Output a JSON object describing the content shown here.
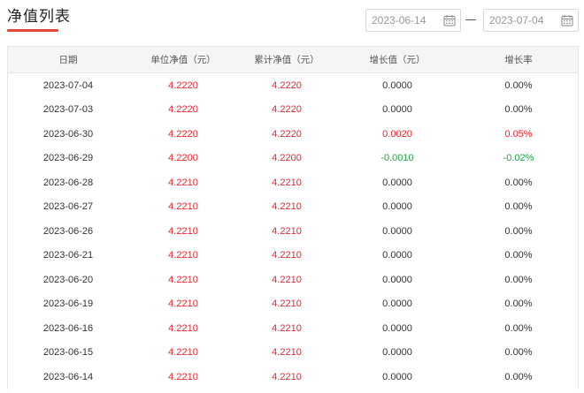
{
  "header": {
    "title": "净值列表"
  },
  "filter": {
    "start_date": "2023-06-14",
    "end_date": "2023-07-04",
    "separator": "—"
  },
  "colors": {
    "accent": "#e8453c",
    "up": "#e8262f",
    "down": "#2aa14a",
    "neutral": "#333333"
  },
  "table": {
    "columns": [
      "日期",
      "单位净值（元）",
      "累计净值（元）",
      "增长值（元）",
      "增长率"
    ],
    "rows": [
      [
        "2023-07-04",
        "4.2220",
        "4.2220",
        "0.0000",
        "0.00%",
        "flat"
      ],
      [
        "2023-07-03",
        "4.2220",
        "4.2220",
        "0.0000",
        "0.00%",
        "flat"
      ],
      [
        "2023-06-30",
        "4.2220",
        "4.2220",
        "0.0020",
        "0.05%",
        "up"
      ],
      [
        "2023-06-29",
        "4.2200",
        "4.2200",
        "-0.0010",
        "-0.02%",
        "down"
      ],
      [
        "2023-06-28",
        "4.2210",
        "4.2210",
        "0.0000",
        "0.00%",
        "flat"
      ],
      [
        "2023-06-27",
        "4.2210",
        "4.2210",
        "0.0000",
        "0.00%",
        "flat"
      ],
      [
        "2023-06-26",
        "4.2210",
        "4.2210",
        "0.0000",
        "0.00%",
        "flat"
      ],
      [
        "2023-06-21",
        "4.2210",
        "4.2210",
        "0.0000",
        "0.00%",
        "flat"
      ],
      [
        "2023-06-20",
        "4.2210",
        "4.2210",
        "0.0000",
        "0.00%",
        "flat"
      ],
      [
        "2023-06-19",
        "4.2210",
        "4.2210",
        "0.0000",
        "0.00%",
        "flat"
      ],
      [
        "2023-06-16",
        "4.2210",
        "4.2210",
        "0.0000",
        "0.00%",
        "flat"
      ],
      [
        "2023-06-15",
        "4.2210",
        "4.2210",
        "0.0000",
        "0.00%",
        "flat"
      ],
      [
        "2023-06-14",
        "4.2210",
        "4.2210",
        "0.0000",
        "0.00%",
        "flat"
      ]
    ]
  }
}
